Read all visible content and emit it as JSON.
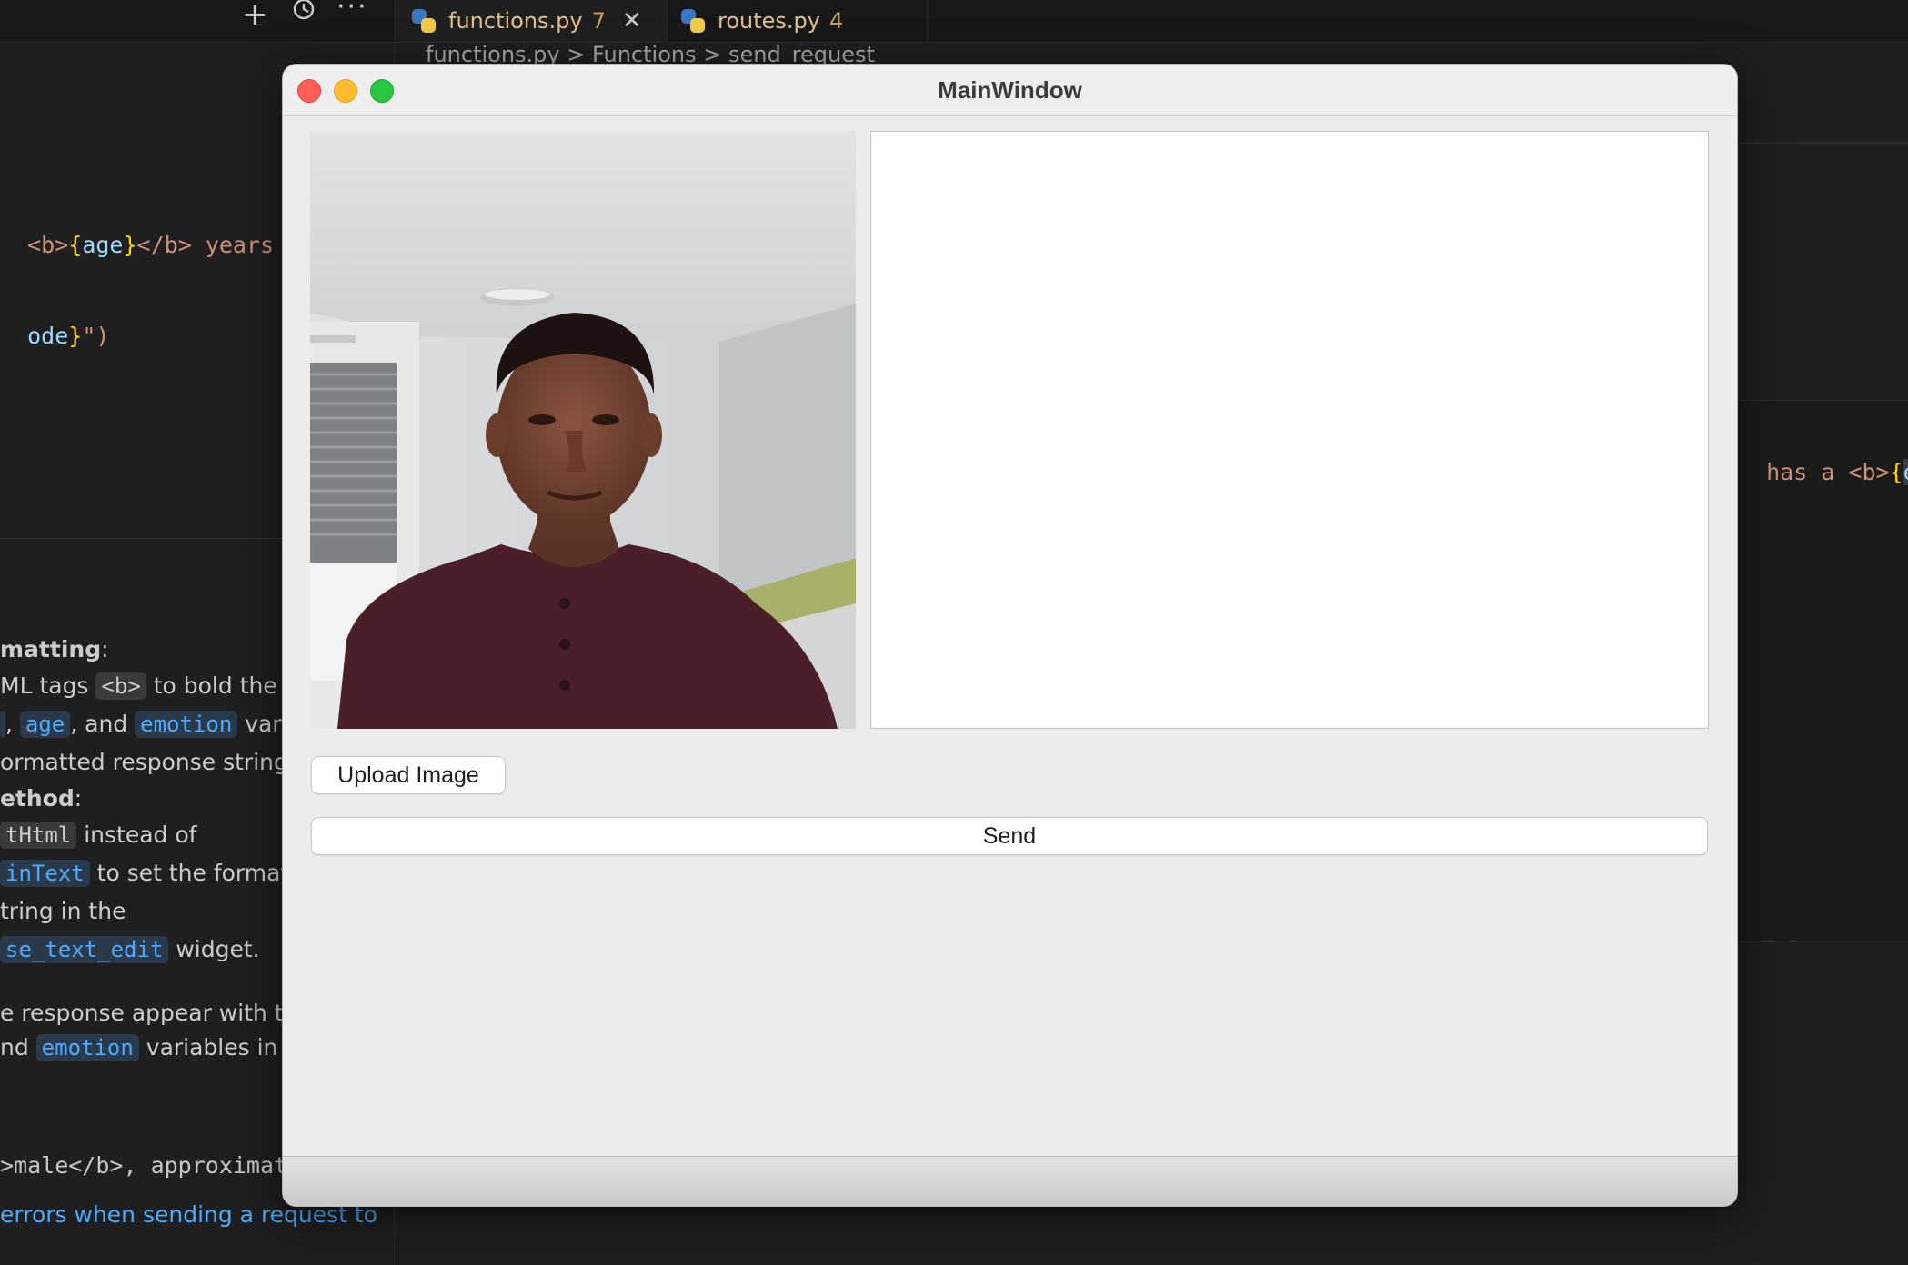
{
  "editor": {
    "tabs": [
      {
        "label": "functions.py",
        "problems": "7",
        "close": "✕"
      },
      {
        "label": "routes.py",
        "problems": "4"
      }
    ],
    "breadcrumb": {
      "file": "functions.py",
      "symbol1": "Functions",
      "symbol2": "send_request",
      "sep": ">"
    },
    "code_left": {
      "line1": {
        "tag_open": "<b>",
        "var": "age",
        "tag_close": "</b>",
        "rest": " years old"
      },
      "line2": {
        "var": "ode",
        "rest": "\")"
      }
    },
    "code_right": {
      "text": "has a <b>",
      "var": "emot"
    },
    "code_bottom": {
      "text": ">male</b>, approximate"
    },
    "chat": {
      "l1_bold": "matting",
      "l1_rest": ":",
      "l2_pre": "ML tags ",
      "l2_chip": "<b>",
      "l2_post": " to bold the",
      "l3_chip1": "",
      "l3_sep1": ", ",
      "l3_chip2": "age",
      "l3_mid": ", and ",
      "l3_chip3": "emotion",
      "l3_post": " vari",
      "l4": "ormatted response string.",
      "l5_bold": "ethod",
      "l5_rest": ":",
      "l6_chip": "tHtml",
      "l6_post": " instead of",
      "l7_chip": "inText",
      "l7_post": " to set the formatt",
      "l8": "tring in the",
      "l9_chip": "se_text_edit",
      "l9_post": " widget.",
      "l10": "e response appear with th",
      "l11_pre": "nd ",
      "l11_chip": "emotion",
      "l11_post": " variables in b",
      "l12": " errors when sending a request to"
    },
    "toolbar_icons": [
      "plus-icon",
      "history-icon",
      "more-icon"
    ]
  },
  "window": {
    "title": "MainWindow",
    "traffic_lights": {
      "close": "#ff5f57",
      "minimize": "#febc2e",
      "maximize": "#28c840"
    },
    "upload_label": "Upload Image",
    "send_label": "Send",
    "response_text": ""
  }
}
